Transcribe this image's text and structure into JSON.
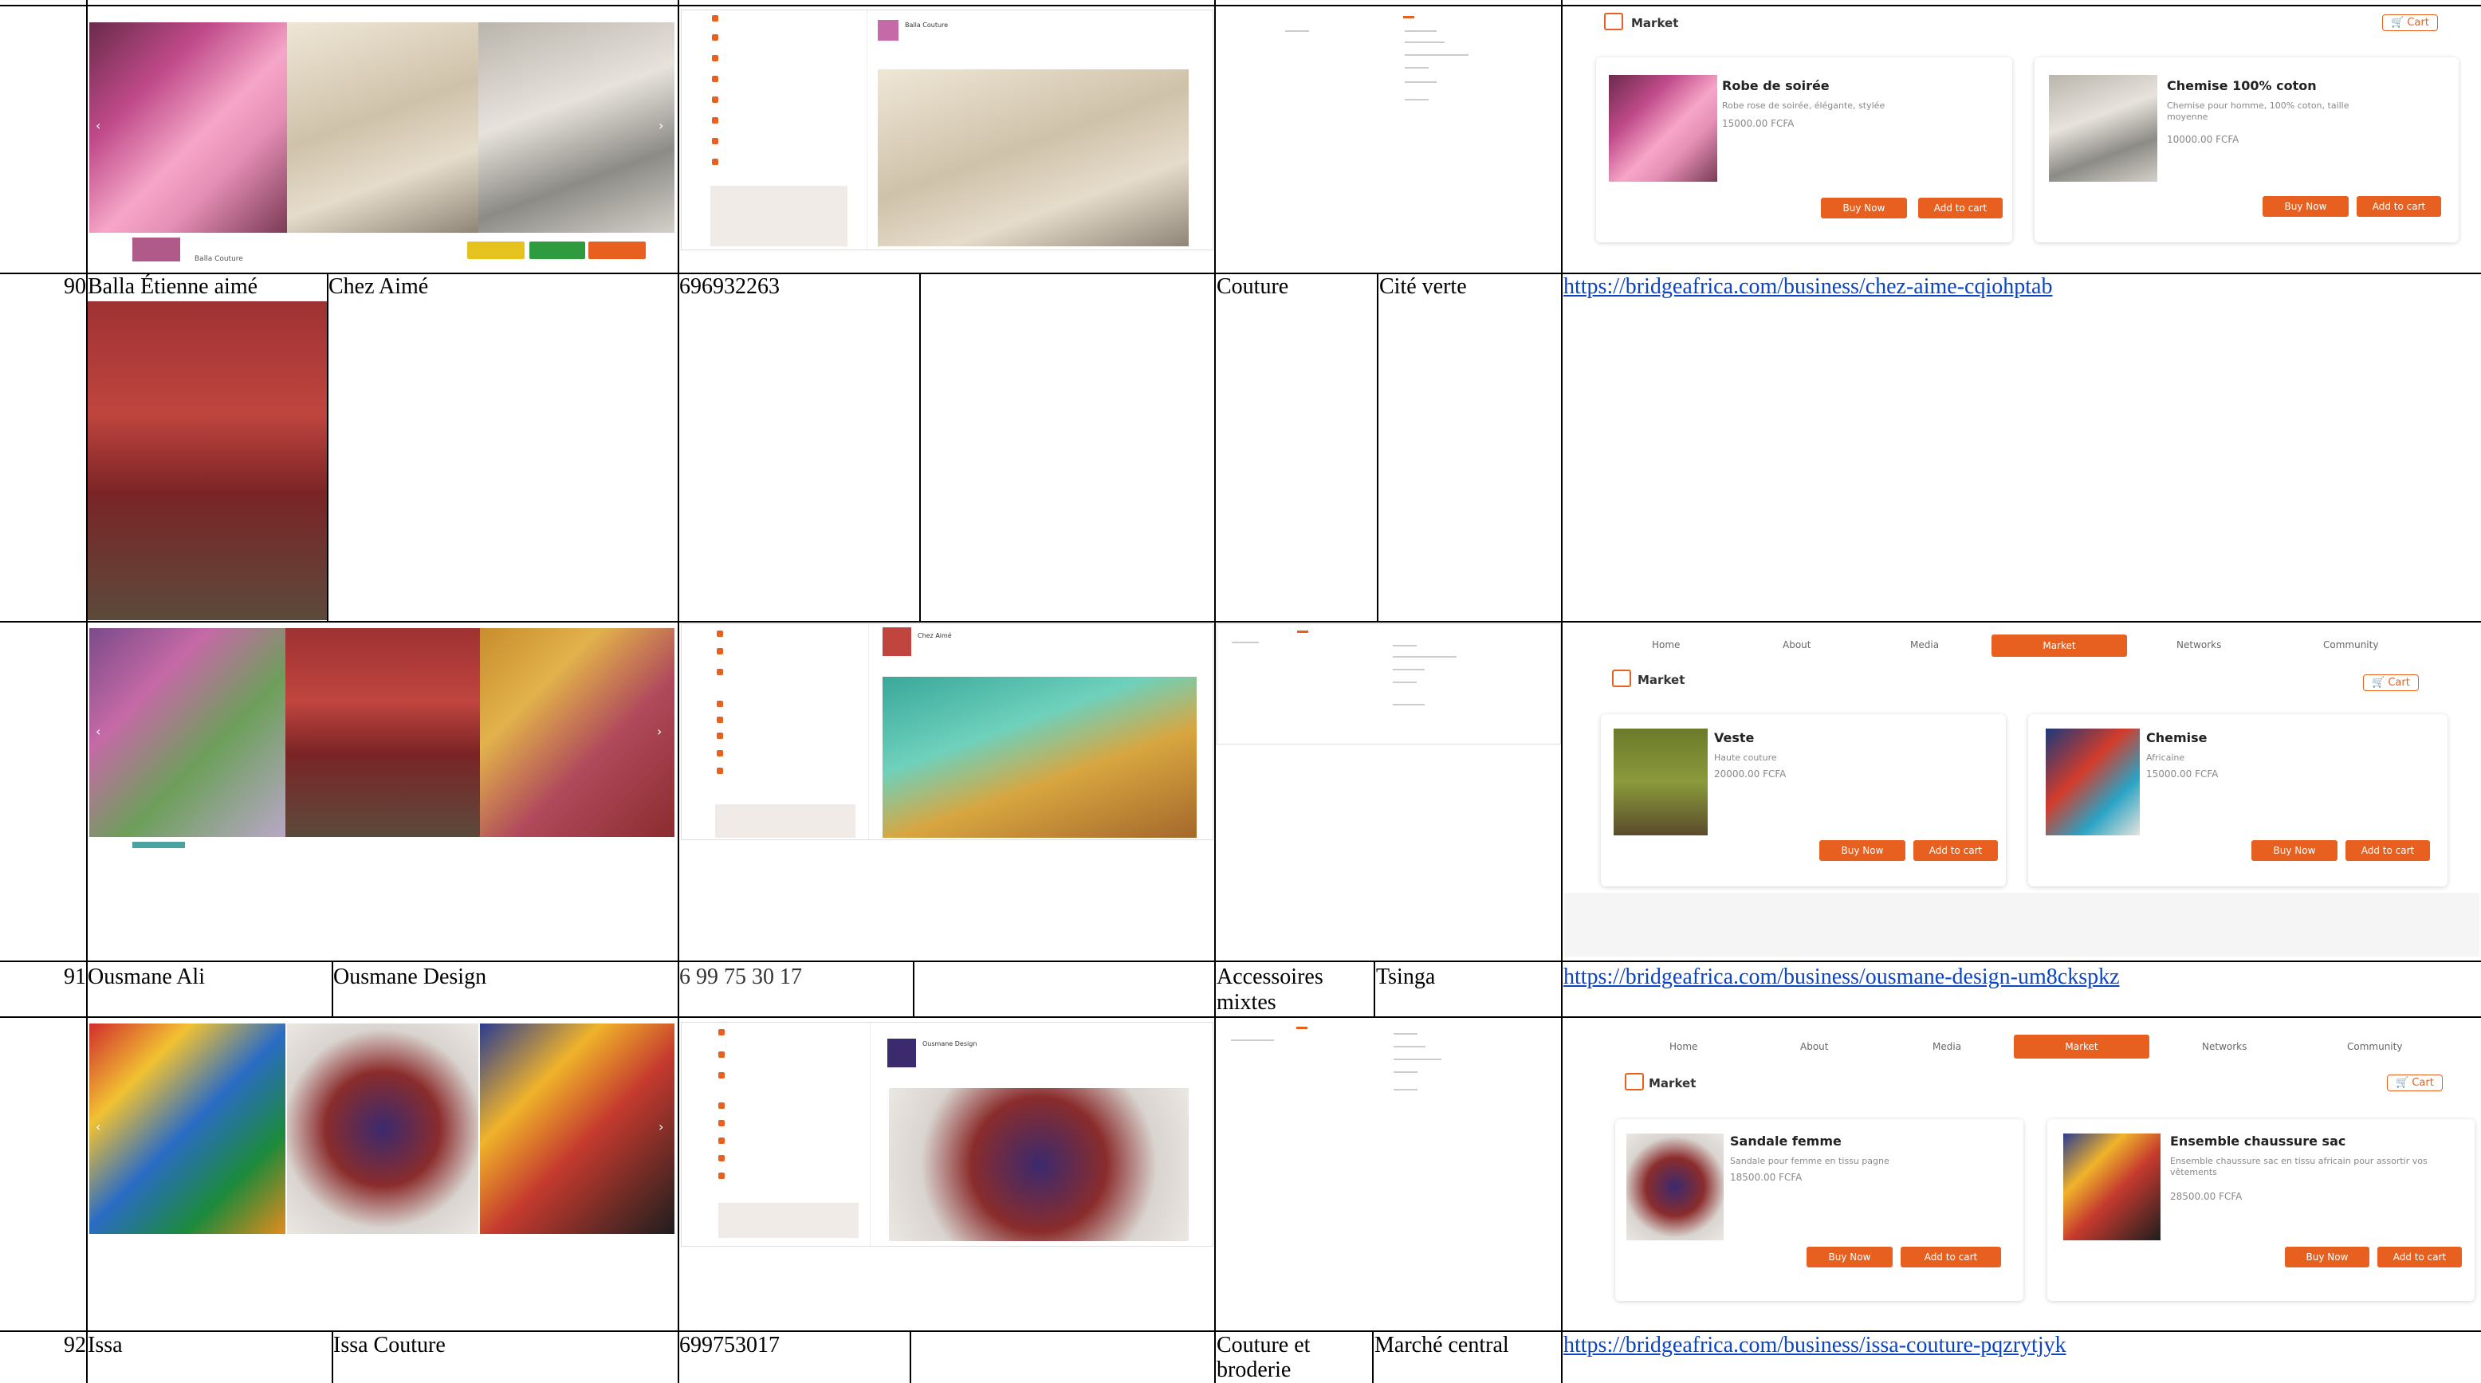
{
  "rows": [
    {
      "num": "90",
      "owner": "Balla Étienne aimé",
      "business": "Chez Aimé",
      "phone": "696932263",
      "category": "Couture",
      "location": "Cité verte",
      "url": "https://bridgeafrica.com/business/chez-aime-cqiohptab"
    },
    {
      "num": "91",
      "owner": "Ousmane Ali",
      "business": "Ousmane Design",
      "phone": "6 99 75 30 17",
      "category": "Accessoires mixtes",
      "location": "Tsinga",
      "url": "https://bridgeafrica.com/business/ousmane-design-um8ckspkz"
    },
    {
      "num": "92",
      "owner": "Issa",
      "business": "Issa Couture",
      "phone": "699753017",
      "category": "Couture et broderie",
      "location": "Marché central",
      "url": "https://bridgeafrica.com/business/issa-couture-pqzrytjyk"
    }
  ],
  "category_lines": {
    "r91": [
      "Accessoires",
      "mixtes"
    ],
    "r92": [
      "Couture et",
      "broderie"
    ]
  },
  "market_label": "Market",
  "cart_label": "Cart",
  "buy_now": "Buy Now",
  "add_to_cart": "Add to cart",
  "nav": [
    "Home",
    "About",
    "Media",
    "Market",
    "Networks",
    "Community"
  ],
  "markets": {
    "m1": [
      {
        "name": "Robe de soirée",
        "desc": "Robe rose de soirée, élégante, stylée",
        "price": "15000.00 FCFA"
      },
      {
        "name": "Chemise 100% coton",
        "desc": "Chemise pour homme, 100% coton, taille moyenne",
        "price": "10000.00 FCFA"
      }
    ],
    "m2": [
      {
        "name": "Veste",
        "desc": "Haute couture",
        "price": "20000.00 FCFA"
      },
      {
        "name": "Chemise",
        "desc": "Africaine",
        "price": "15000.00 FCFA"
      }
    ],
    "m3": [
      {
        "name": "Sandale femme",
        "desc": "Sandale pour femme en tissu pagne",
        "price": "18500.00 FCFA"
      },
      {
        "name": "Ensemble chaussure sac",
        "desc": "Ensemble chaussure sac en tissu africain pour assortir vos vêtements",
        "price": "28500.00 FCFA"
      }
    ]
  },
  "profile_names": {
    "p1": "Balla Couture",
    "p2": "Chez Aimé",
    "p3": "Ousmane Design"
  },
  "accent": "#e8601f",
  "link_color": "#0b45c7"
}
